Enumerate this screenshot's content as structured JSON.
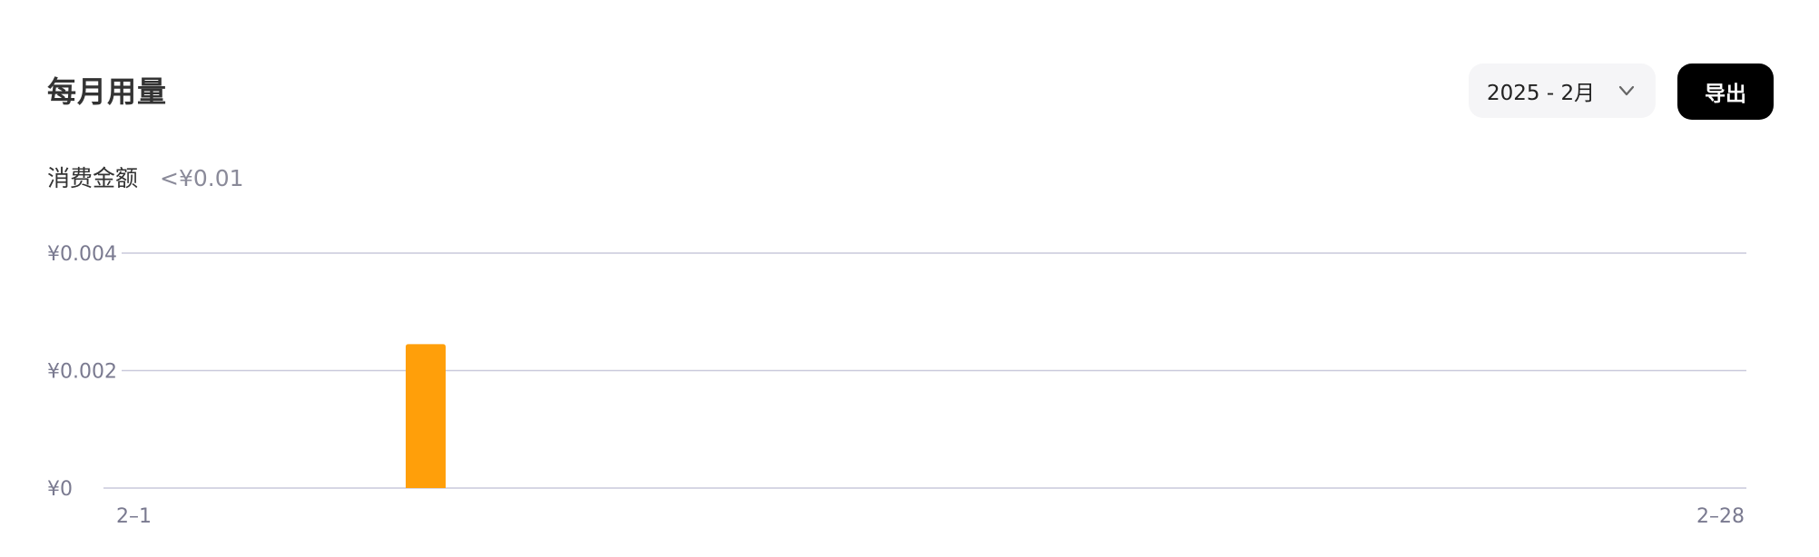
{
  "header": {
    "title": "每月用量",
    "month_selector_value": "2025 - 2月",
    "export_label": "导出"
  },
  "summary": {
    "label": "消费金额",
    "amount": "<¥0.01"
  },
  "colors": {
    "bar": "#ff9f0a",
    "grid": "#c9c9dc",
    "axis_text": "#7a7a90",
    "button_bg": "#000000",
    "select_bg": "#f5f5f7"
  },
  "chart_data": {
    "type": "bar",
    "x_range": [
      1,
      28
    ],
    "x_tick_labels": [
      "2–1",
      "2–28"
    ],
    "y_ticks": [
      0,
      0.002,
      0.004
    ],
    "y_tick_labels": [
      "¥0",
      "¥0.002",
      "¥0.004"
    ],
    "ylim": [
      0,
      0.004
    ],
    "grid": true,
    "points": [
      {
        "day": 6,
        "value": 0.00245
      }
    ],
    "series": [
      {
        "values": [
          0,
          0,
          0,
          0,
          0,
          0.00245,
          0,
          0,
          0,
          0,
          0,
          0,
          0,
          0,
          0,
          0,
          0,
          0,
          0,
          0,
          0,
          0,
          0,
          0,
          0,
          0,
          0,
          0
        ]
      }
    ]
  }
}
